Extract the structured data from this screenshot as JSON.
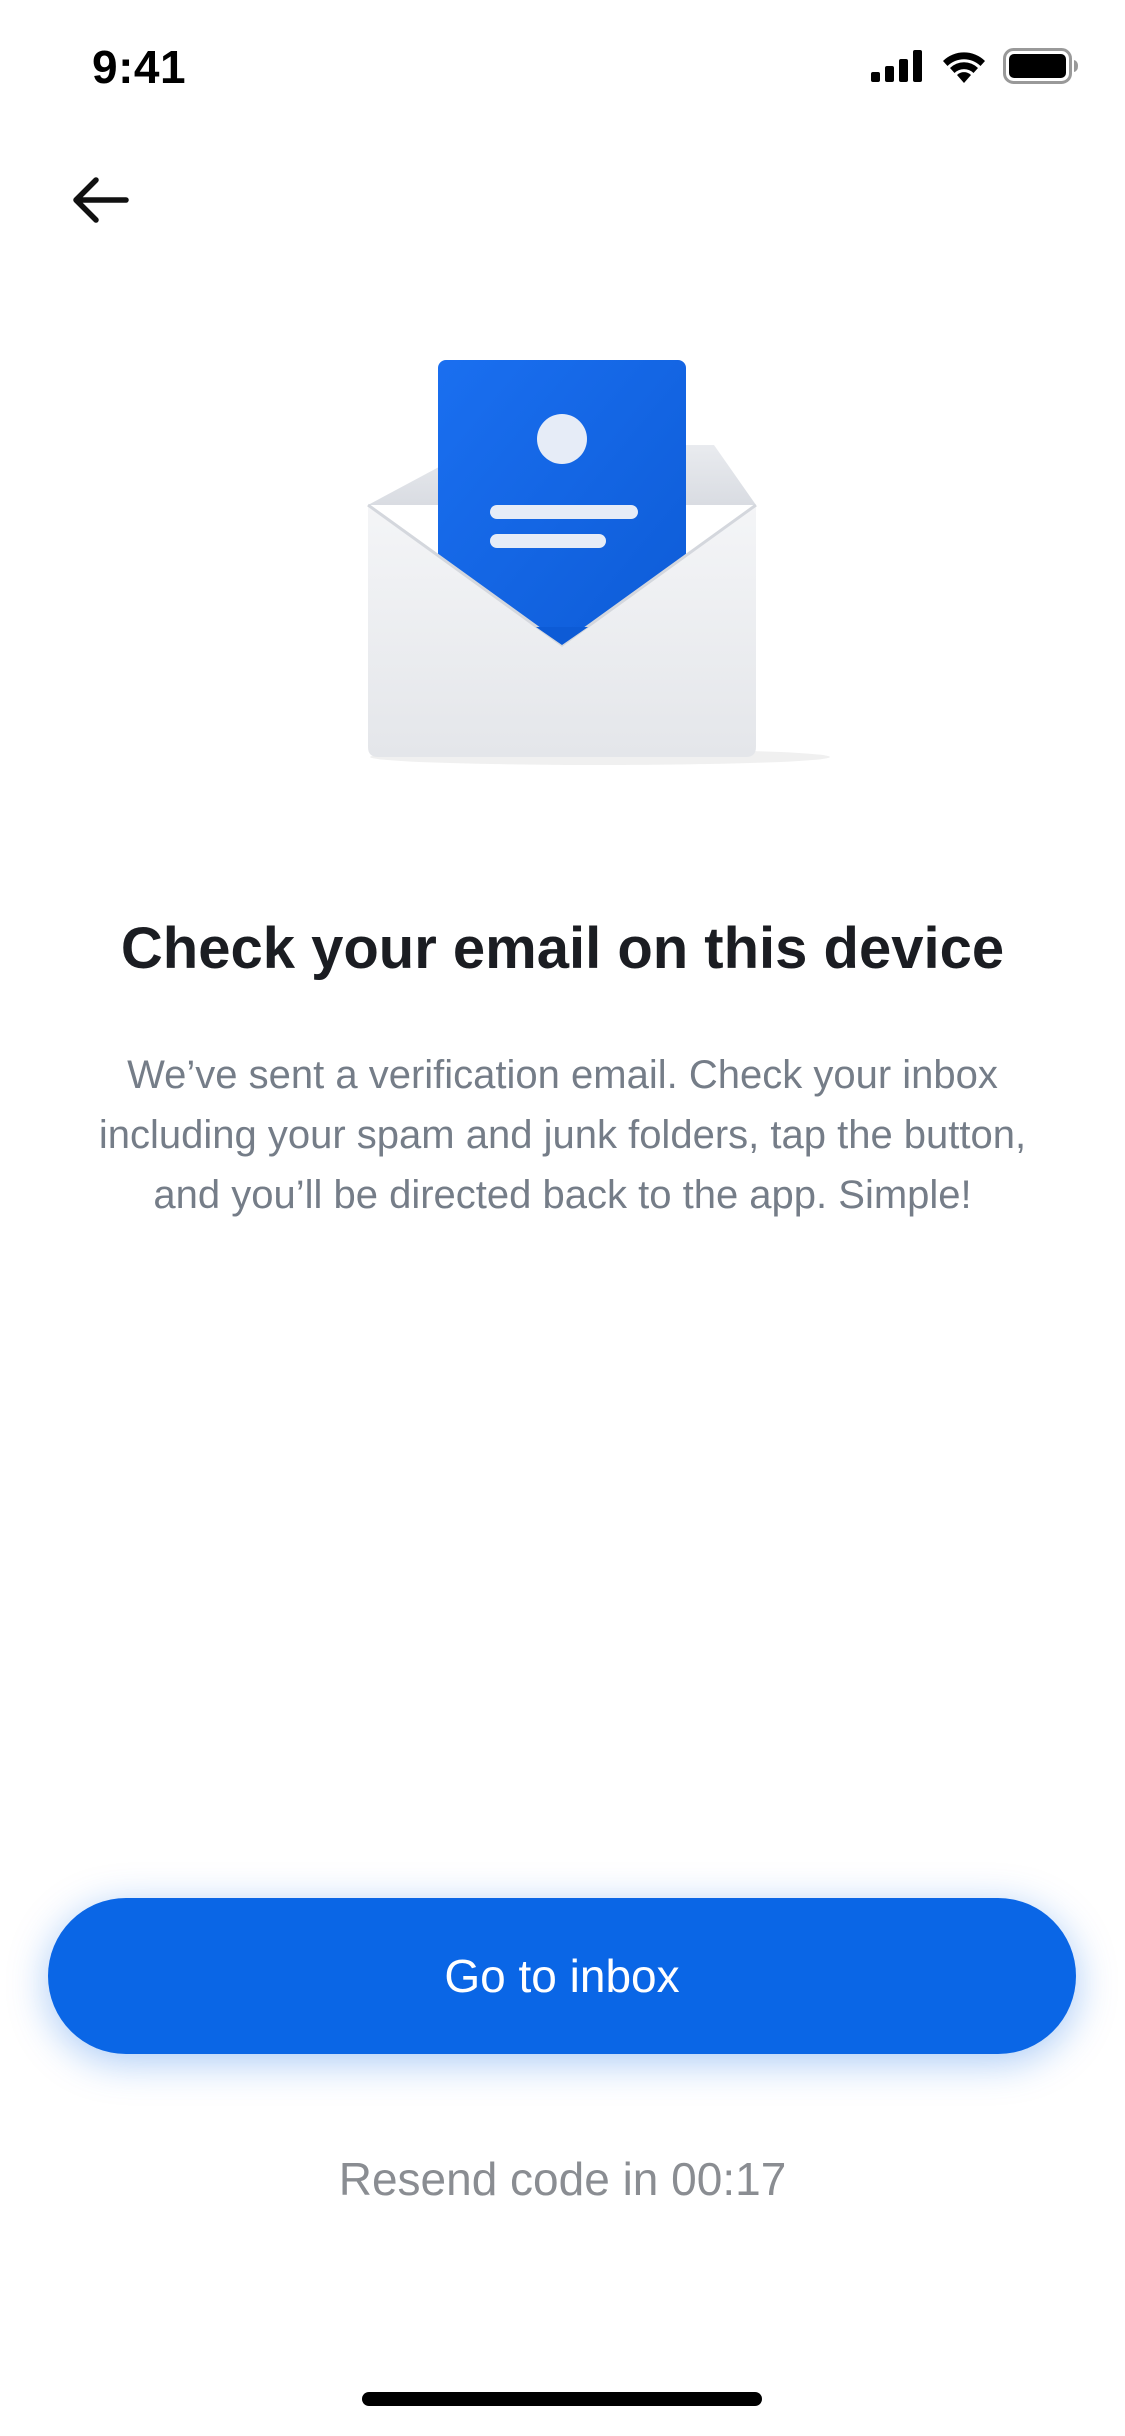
{
  "status_bar": {
    "time": "9:41"
  },
  "nav": {
    "back_icon": "arrow-left-icon"
  },
  "hero": {
    "icon": "envelope-with-letter-illustration",
    "accent_color": "#1366e0"
  },
  "content": {
    "title": "Check your email on this device",
    "body_line_1": "We’ve sent a verification email. Check your inbox",
    "body_line_2": "including your spam and junk folders, tap the button,",
    "body_line_3": "and you’ll be directed back to the app. Simple!"
  },
  "actions": {
    "primary_label": "Go to inbox",
    "primary_color": "#0a66e6",
    "resend_text": "Resend code in 00:17"
  }
}
